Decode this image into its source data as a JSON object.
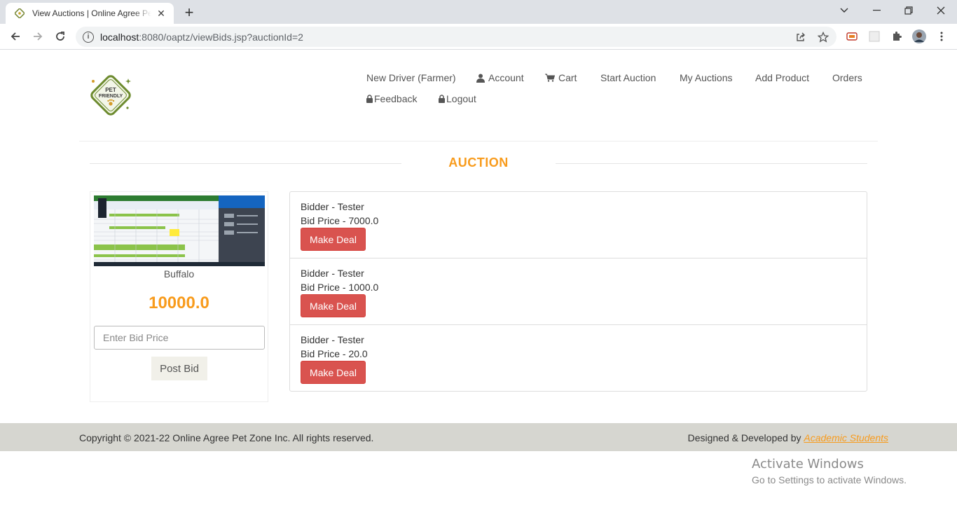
{
  "browser": {
    "tab_title": "View Auctions | Online Agree Pet Zone",
    "url_host": "localhost",
    "url_rest": ":8080/oaptz/viewBids.jsp?auctionId=2"
  },
  "logo": {
    "line1": "PET",
    "line2": "FRIENDLY"
  },
  "nav": {
    "new_driver": "New Driver (Farmer)",
    "account": "Account",
    "cart": "Cart",
    "start_auction": "Start Auction",
    "my_auctions": "My Auctions",
    "add_product": "Add Product",
    "orders": "Orders",
    "feedback": "Feedback",
    "logout": "Logout"
  },
  "heading": "AUCTION",
  "product": {
    "name": "Buffalo",
    "price": "10000.0",
    "bid_placeholder": "Enter Bid Price",
    "post_label": "Post Bid"
  },
  "bids": [
    {
      "bidder": "Bidder - Tester",
      "price": "Bid Price - 7000.0",
      "action": "Make Deal"
    },
    {
      "bidder": "Bidder - Tester",
      "price": "Bid Price - 1000.0",
      "action": "Make Deal"
    },
    {
      "bidder": "Bidder - Tester",
      "price": "Bid Price - 20.0",
      "action": "Make Deal"
    }
  ],
  "footer": {
    "copyright": "Copyright © 2021-22 Online Agree Pet Zone Inc. All rights reserved.",
    "credit_prefix": "Designed & Developed by ",
    "credit_link": "Academic Students"
  },
  "watermark": {
    "line1": "Activate Windows",
    "line2": "Go to Settings to activate Windows."
  },
  "colors": {
    "accent": "#f89b1c",
    "danger": "#d9534f",
    "footer_bg": "#d6d6d0"
  }
}
